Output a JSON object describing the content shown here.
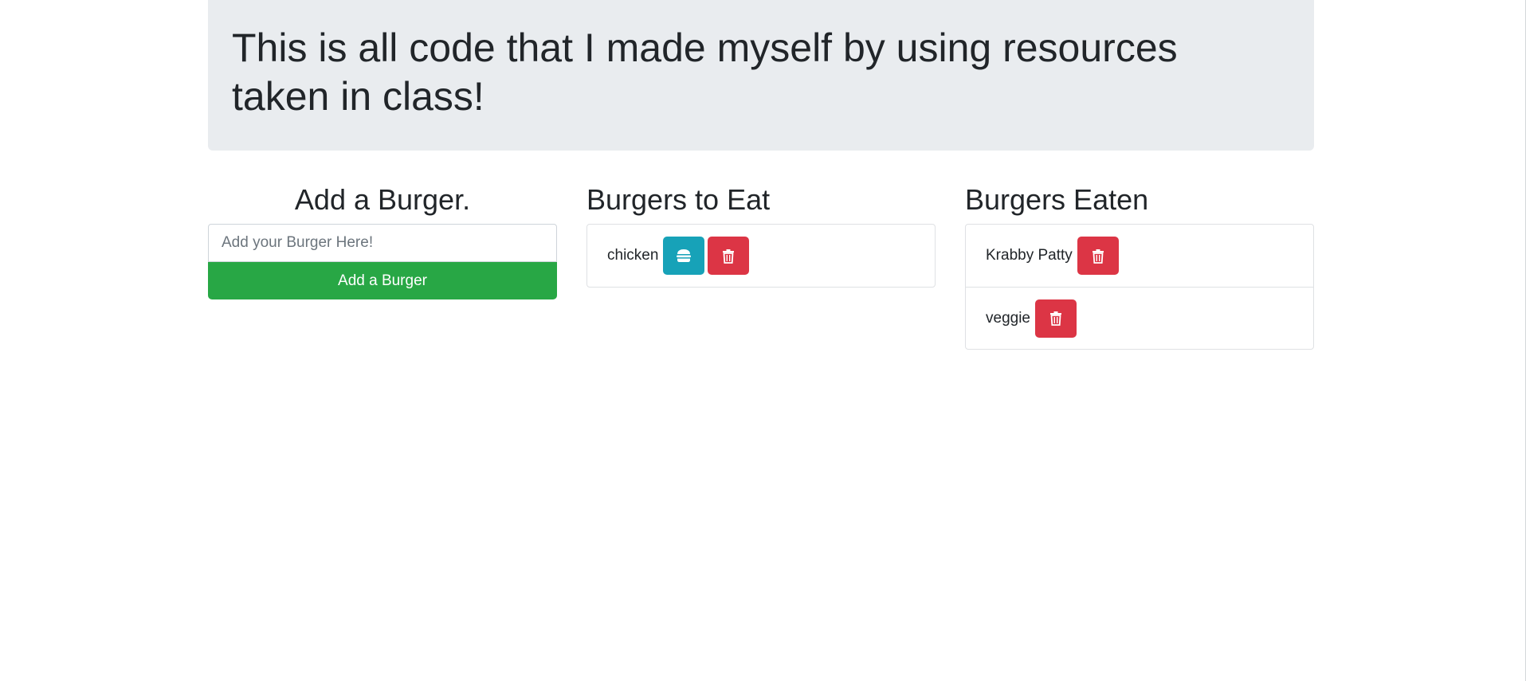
{
  "header": {
    "title": "This is all code that I made myself by using resources taken in class!"
  },
  "add_section": {
    "heading": "Add a Burger.",
    "input_placeholder": "Add your Burger Here!",
    "input_value": "",
    "button_label": "Add a Burger"
  },
  "to_eat_section": {
    "heading": "Burgers to Eat",
    "items": [
      {
        "name": "chicken",
        "actions": [
          "hamburger-icon",
          "trash-icon"
        ]
      }
    ]
  },
  "eaten_section": {
    "heading": "Burgers Eaten",
    "items": [
      {
        "name": "Krabby Patty",
        "actions": [
          "trash-icon"
        ]
      },
      {
        "name": "veggie",
        "actions": [
          "trash-icon"
        ]
      }
    ]
  },
  "colors": {
    "jumbotron_bg": "#e9ecef",
    "success": "#28a745",
    "info": "#17a2b8",
    "danger": "#dc3545"
  }
}
